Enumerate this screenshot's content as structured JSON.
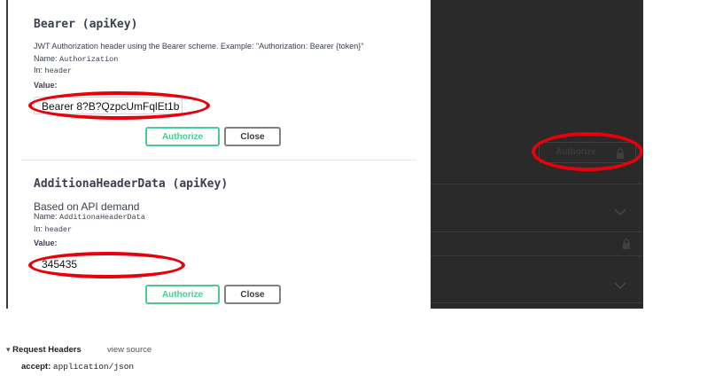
{
  "bearer": {
    "title": "Bearer  (apiKey)",
    "description": "JWT Authorization header using the Bearer scheme. Example: \"Authorization: Bearer {token}\"",
    "name_label": "Name:",
    "name_value": "Authorization",
    "in_label": "In:",
    "in_value": "header",
    "value_label": "Value:",
    "value": "Bearer 8?B?QzpcUmFqlEt1b",
    "authorize_label": "Authorize",
    "close_label": "Close"
  },
  "additional": {
    "title": "AdditionaHeaderData (apiKey)",
    "description": "Based on API demand",
    "name_label": "Name:",
    "name_value": "AdditionaHeaderData",
    "in_label": "In:",
    "in_value": "header",
    "value_label": "Value:",
    "value": "345435",
    "authorize_label": "Authorize",
    "close_label": "Close"
  },
  "background": {
    "authorize_label": "Authorize",
    "lock_icon": "lock-icon",
    "chevron_icon": "chevron-down-icon"
  },
  "request_headers": {
    "toggle": "▾",
    "title": "Request Headers",
    "view_source": "view source",
    "header_name": "accept:",
    "header_value": "application/json"
  },
  "colors": {
    "authorize_green": "#49cc90",
    "annotation_red": "#e8000b",
    "dark_bg": "#2a2a2a"
  }
}
